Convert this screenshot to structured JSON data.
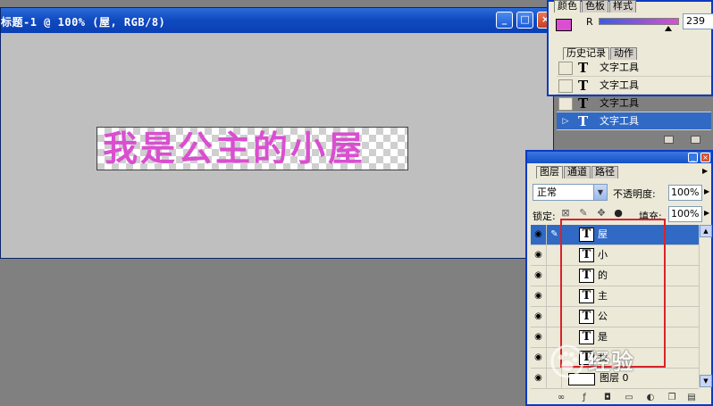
{
  "document": {
    "title": "标题-1 @ 100% (屋, RGB/8)",
    "canvas_text": "我是公主的小屋",
    "text_color": "#d94fd0",
    "buttons": [
      "_",
      "□",
      "×"
    ]
  },
  "color_palette": {
    "tabs": [
      "颜色",
      "色板",
      "样式"
    ],
    "channel_label": "R",
    "channel_value": "239",
    "swatch_color": "#d94fd0"
  },
  "history_palette": {
    "tabs": [
      "历史记录",
      "动作"
    ],
    "items": [
      {
        "label": "文字工具",
        "selected": false
      },
      {
        "label": "文字工具",
        "selected": false
      },
      {
        "label": "文字工具",
        "selected": false
      },
      {
        "label": "文字工具",
        "selected": true
      }
    ]
  },
  "layers_palette": {
    "tabs": [
      "图层",
      "通道",
      "路径"
    ],
    "blend_mode": "正常",
    "opacity_label": "不透明度:",
    "opacity_value": "100%",
    "lock_label": "锁定:",
    "fill_label": "填充:",
    "fill_value": "100%",
    "layers": [
      {
        "name": "屋",
        "type": "text",
        "selected": true
      },
      {
        "name": "小",
        "type": "text",
        "selected": false
      },
      {
        "name": "的",
        "type": "text",
        "selected": false
      },
      {
        "name": "主",
        "type": "text",
        "selected": false
      },
      {
        "name": "公",
        "type": "text",
        "selected": false
      },
      {
        "name": "是",
        "type": "text",
        "selected": false
      },
      {
        "name": "我",
        "type": "text",
        "selected": false
      },
      {
        "name": "图层 0",
        "type": "pixel",
        "selected": false
      }
    ],
    "highlight_color": "#d8232a"
  },
  "icons": {
    "text_layer": "T",
    "eye": "eye-icon"
  },
  "watermark": {
    "text": "经验"
  }
}
